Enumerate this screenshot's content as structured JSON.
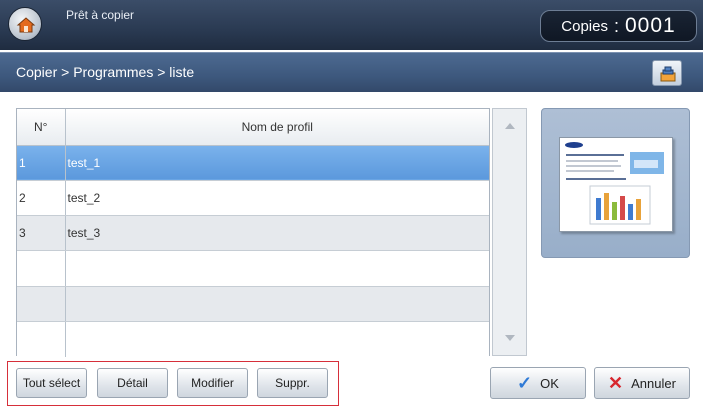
{
  "header": {
    "status_text": "Prêt à copier",
    "copies_label": "Copies",
    "copies_colon": ":",
    "copies_value": "0001",
    "home_icon": "home-icon"
  },
  "nav": {
    "breadcrumb": "Copier > Programmes > liste",
    "right_icon": "stack-icon"
  },
  "table": {
    "col_number_header": "N°",
    "col_name_header": "Nom de profil",
    "rows": [
      {
        "number": "1",
        "name": "test_1",
        "selected": true
      },
      {
        "number": "2",
        "name": "test_2",
        "selected": false
      },
      {
        "number": "3",
        "name": "test_3",
        "selected": false
      },
      {
        "number": "",
        "name": "",
        "selected": false
      },
      {
        "number": "",
        "name": "",
        "selected": false
      },
      {
        "number": "",
        "name": "",
        "selected": false
      }
    ]
  },
  "scroll": {
    "up_icon": "scroll-up-icon",
    "down_icon": "scroll-down-icon"
  },
  "buttons": {
    "select_all": "Tout sélect",
    "detail": "Détail",
    "modify": "Modifier",
    "delete": "Suppr.",
    "ok": "OK",
    "cancel": "Annuler"
  },
  "colors": {
    "selected_row": "#6aa6e6",
    "highlight_border": "#d62f3a",
    "ok_check": "#2f7ad6",
    "cancel_x": "#d7262e"
  }
}
